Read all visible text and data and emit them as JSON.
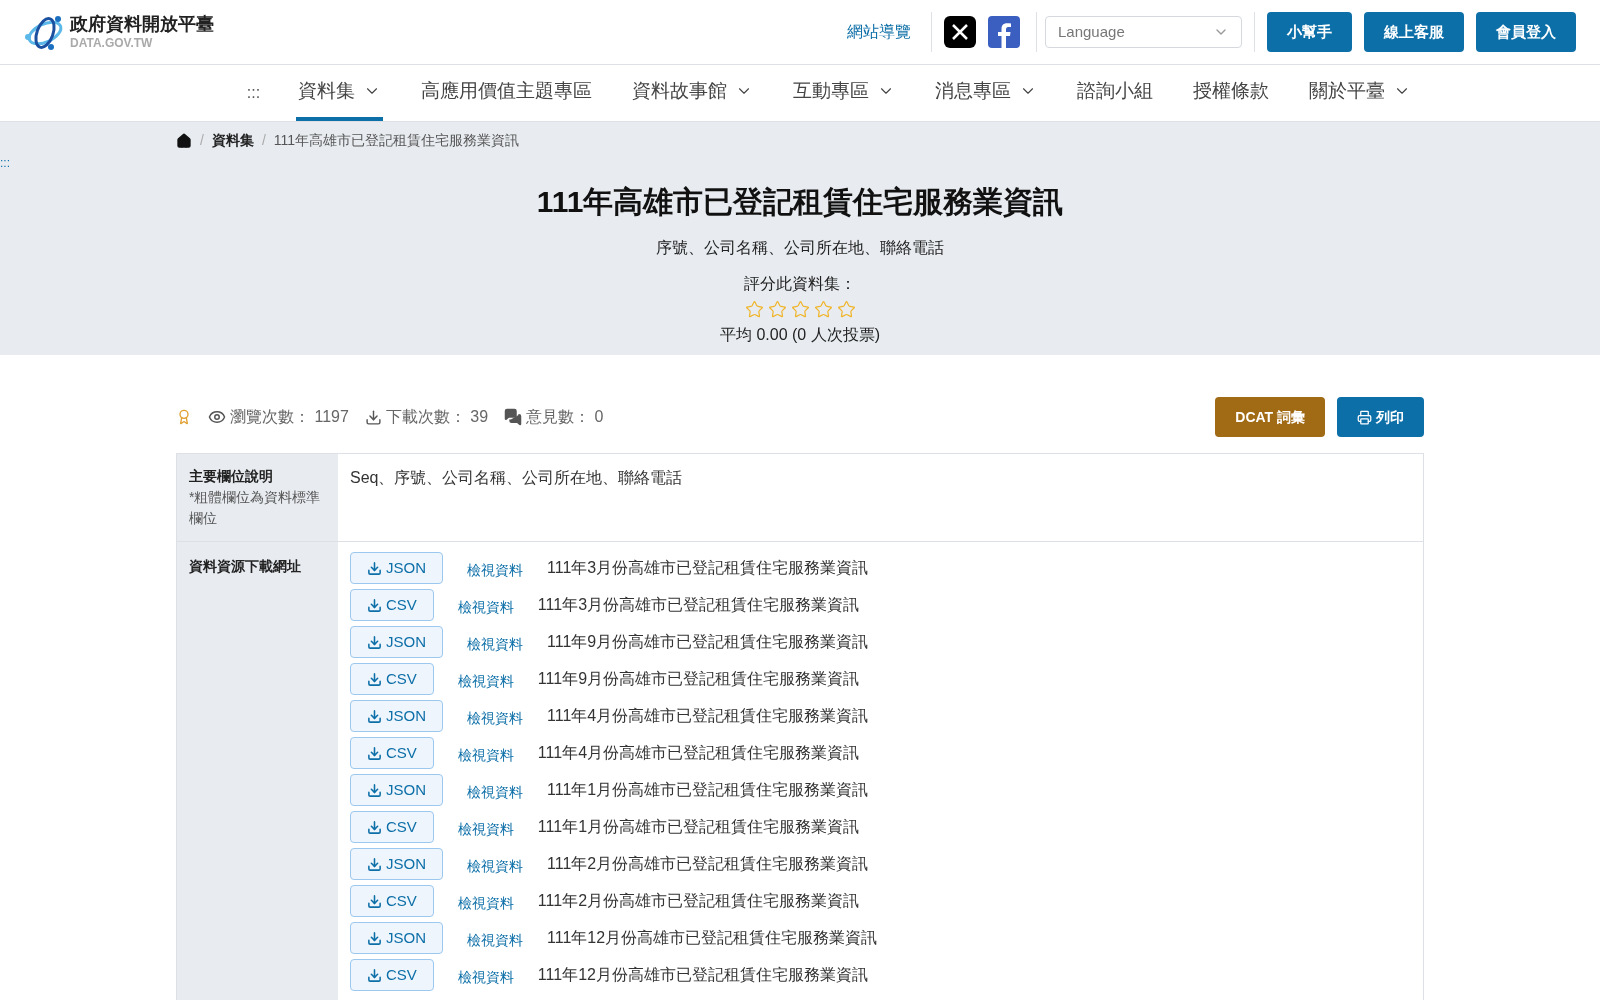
{
  "header": {
    "logo_title": "政府資料開放平臺",
    "logo_subtitle": "DATA.GOV.TW",
    "sitemap_link": "網站導覽",
    "language": {
      "placeholder": "Language"
    },
    "buttons": [
      "小幫手",
      "線上客服",
      "會員登入"
    ]
  },
  "nav": {
    "menu_glyph": ":::",
    "items": [
      {
        "label": "資料集",
        "dropdown": true,
        "selected": true
      },
      {
        "label": "高應用價值主題專區",
        "dropdown": false,
        "selected": false
      },
      {
        "label": "資料故事館",
        "dropdown": true,
        "selected": false
      },
      {
        "label": "互動專區",
        "dropdown": true,
        "selected": false
      },
      {
        "label": "消息專區",
        "dropdown": true,
        "selected": false
      },
      {
        "label": "諮詢小組",
        "dropdown": false,
        "selected": false
      },
      {
        "label": "授權條款",
        "dropdown": false,
        "selected": false
      },
      {
        "label": "關於平臺",
        "dropdown": true,
        "selected": false
      }
    ]
  },
  "skip_glyph": ":::",
  "breadcrumb": [
    "資料集",
    "111年高雄市已登記租賃住宅服務業資訊"
  ],
  "breadcrumb_separator": "/",
  "hero": {
    "title": "111年高雄市已登記租賃住宅服務業資訊",
    "description": "序號、公司名稱、公司所在地、聯絡電話",
    "rate_label": "評分此資料集：",
    "stars": 0,
    "average": "平均 0.00 (0 人次投票)"
  },
  "stats": [
    {
      "kind": "views",
      "label": "瀏覽次數：",
      "value": "1197"
    },
    {
      "kind": "downloads",
      "label": "下載次數：",
      "value": "39"
    },
    {
      "kind": "comments",
      "label": "意見數：",
      "value": "0"
    }
  ],
  "actions": [
    {
      "kind": "dcat",
      "label": "DCAT 詞彙"
    },
    {
      "kind": "print",
      "label": "列印"
    }
  ],
  "details": {
    "fields_label": "主要欄位說明",
    "fields_note": "*粗體欄位為資料標準欄位",
    "fields_value": "Seq、序號、公司名稱、公司所在地、聯絡電話",
    "resources_label": "資料資源下載網址",
    "resources": [
      {
        "format": "JSON",
        "view": "檢視資料",
        "name": "111年3月份高雄市已登記租賃住宅服務業資訊"
      },
      {
        "format": "CSV",
        "view": "檢視資料",
        "name": "111年3月份高雄市已登記租賃住宅服務業資訊"
      },
      {
        "format": "JSON",
        "view": "檢視資料",
        "name": "111年9月份高雄市已登記租賃住宅服務業資訊"
      },
      {
        "format": "CSV",
        "view": "檢視資料",
        "name": "111年9月份高雄市已登記租賃住宅服務業資訊"
      },
      {
        "format": "JSON",
        "view": "檢視資料",
        "name": "111年4月份高雄市已登記租賃住宅服務業資訊"
      },
      {
        "format": "CSV",
        "view": "檢視資料",
        "name": "111年4月份高雄市已登記租賃住宅服務業資訊"
      },
      {
        "format": "JSON",
        "view": "檢視資料",
        "name": "111年1月份高雄市已登記租賃住宅服務業資訊"
      },
      {
        "format": "CSV",
        "view": "檢視資料",
        "name": "111年1月份高雄市已登記租賃住宅服務業資訊"
      },
      {
        "format": "JSON",
        "view": "檢視資料",
        "name": "111年2月份高雄市已登記租賃住宅服務業資訊"
      },
      {
        "format": "CSV",
        "view": "檢視資料",
        "name": "111年2月份高雄市已登記租賃住宅服務業資訊"
      },
      {
        "format": "JSON",
        "view": "檢視資料",
        "name": "111年12月份高雄市已登記租賃住宅服務業資訊"
      },
      {
        "format": "CSV",
        "view": "檢視資料",
        "name": "111年12月份高雄市已登記租賃住宅服務業資訊"
      }
    ]
  }
}
